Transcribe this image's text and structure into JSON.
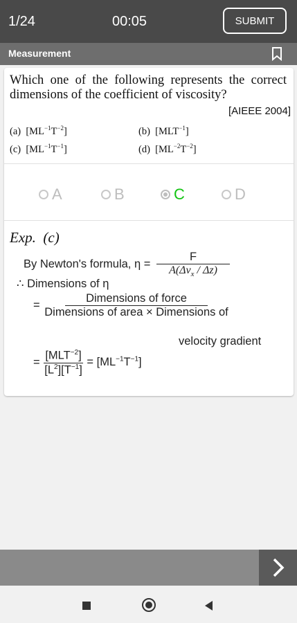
{
  "header": {
    "question_counter": "1/24",
    "timer": "00:05",
    "submit_label": "SUBMIT"
  },
  "topic": {
    "label": "Measurement",
    "bookmark_icon": "bookmark-icon"
  },
  "question": {
    "text": "Which one of the following represents the correct dimensions of the coefficient of viscosity?",
    "source": "[AIEEE 2004]",
    "options": {
      "a": {
        "prefix": "(a)",
        "body": "[ML",
        "exp1": "−1",
        "mid": "T",
        "exp2": "−2",
        "end": "]"
      },
      "b": {
        "prefix": "(b)",
        "body": "[MLT",
        "exp1": "−1",
        "end": "]"
      },
      "c": {
        "prefix": "(c)",
        "body": "[ML",
        "exp1": "−1",
        "mid": "T",
        "exp2": "−1",
        "end": "]"
      },
      "d": {
        "prefix": "(d)",
        "body": "[ML",
        "exp1": "−2",
        "mid": "T",
        "exp2": "−2",
        "end": "]"
      }
    }
  },
  "answer_choices": [
    {
      "label": "A",
      "selected": false,
      "correct": false
    },
    {
      "label": "B",
      "selected": false,
      "correct": false
    },
    {
      "label": "C",
      "selected": true,
      "correct": true
    },
    {
      "label": "D",
      "selected": false,
      "correct": false
    }
  ],
  "explanation": {
    "heading": "Exp.",
    "answer": "(c)",
    "line1_text": "By Newton's formula, η =",
    "line1_num": "F",
    "line1_den": "A(Δv",
    "line1_den_sub": "x",
    "line1_den_end": " / Δz)",
    "line2_text": "∴ Dimensions of η",
    "line3_eq": "=",
    "line3_num": "Dimensions of force",
    "line3_den": "Dimensions of area × Dimensions of",
    "line3_den2": "velocity gradient",
    "line4_eq": "=",
    "line4_num": "[MLT",
    "line4_num_exp": "−2",
    "line4_num_end": "]",
    "line4_den_a": "[L",
    "line4_den_a_exp": "2",
    "line4_den_b": "][T",
    "line4_den_b_exp": "−1",
    "line4_den_end": "]",
    "line4_result": "= [ML",
    "line4_result_exp1": "−1",
    "line4_result_mid": "T",
    "line4_result_exp2": "−1",
    "line4_result_end": "]"
  },
  "colors": {
    "header_bg": "#494949",
    "topic_bg": "#6e6e6e",
    "correct": "#13c413",
    "inactive_choice": "#bdbdbd"
  }
}
